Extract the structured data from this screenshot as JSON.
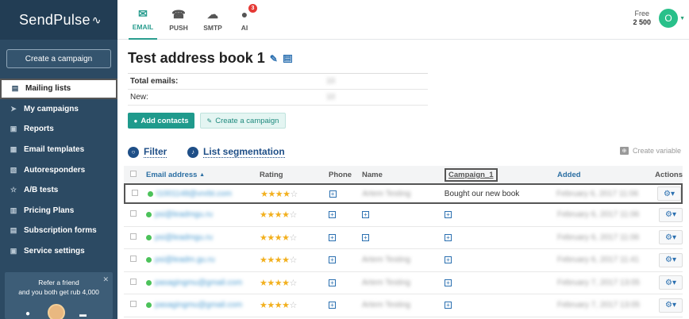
{
  "brand": {
    "name": "SendPulse",
    "pulse": "∠"
  },
  "sidebar": {
    "create_campaign": "Create a campaign",
    "items": [
      {
        "label": "Mailing lists",
        "icon": "book-icon",
        "glyph": "▤"
      },
      {
        "label": "My campaigns",
        "icon": "paper-plane-icon",
        "glyph": "➤"
      },
      {
        "label": "Reports",
        "icon": "chart-icon",
        "glyph": "▣"
      },
      {
        "label": "Email templates",
        "icon": "template-icon",
        "glyph": "▦"
      },
      {
        "label": "Autoresponders",
        "icon": "autoresponder-icon",
        "glyph": "▧"
      },
      {
        "label": "A/B tests",
        "icon": "ab-test-icon",
        "glyph": "☆"
      },
      {
        "label": "Pricing Plans",
        "icon": "pricing-icon",
        "glyph": "▥"
      },
      {
        "label": "Subscription forms",
        "icon": "form-icon",
        "glyph": "▤"
      },
      {
        "label": "Service settings",
        "icon": "settings-icon",
        "glyph": "▣"
      }
    ],
    "refer": {
      "line1": "Refer a friend",
      "line2": "and you both get rub 4,000"
    }
  },
  "topbar": {
    "tabs": [
      {
        "label": "EMAIL",
        "glyph": "✉"
      },
      {
        "label": "PUSH",
        "glyph": "☎"
      },
      {
        "label": "SMTP",
        "glyph": "☁"
      },
      {
        "label": "AI",
        "glyph": "●",
        "badge": "3"
      }
    ],
    "plan_label": "Free",
    "plan_value": "2 500",
    "avatar_letter": "O"
  },
  "page": {
    "title": "Test address book 1",
    "stats": [
      {
        "label": "Total emails:",
        "value": "10"
      },
      {
        "label": "New:",
        "value": "10"
      }
    ],
    "add_contacts": "Add contacts",
    "create_campaign": "Create a campaign",
    "filter": "Filter",
    "segmentation": "List segmentation",
    "create_variable": "Create variable"
  },
  "table": {
    "headers": {
      "email": "Email address",
      "rating": "Rating",
      "phone": "Phone",
      "name": "Name",
      "campaign": "Campaign_1",
      "added": "Added",
      "actions": "Actions"
    },
    "rows": [
      {
        "email": "t1001148@vnrbt.com",
        "rating": 4,
        "name": "Artem Testing",
        "campaign": "Bought our new book",
        "added": "February 6, 2017 11:06"
      },
      {
        "email": "psi@leadmgu.ru",
        "rating": 4,
        "name": "",
        "campaign": "",
        "added": "February 6, 2017 11:06"
      },
      {
        "email": "psi@leadmgu.ru",
        "rating": 4,
        "name": "",
        "campaign": "",
        "added": "February 6, 2017 11:06"
      },
      {
        "email": "psi@leadm.gu.ru",
        "rating": 4,
        "name": "Artem Testing",
        "campaign": "",
        "added": "February 6, 2017 11:41"
      },
      {
        "email": "pasagingmu@gmail.com",
        "rating": 4,
        "name": "Artem Testing",
        "campaign": "",
        "added": "February 7, 2017 13:05"
      },
      {
        "email": "pasagingmu@gmail.com",
        "rating": 4,
        "name": "Artem Testing",
        "campaign": "",
        "added": "February 7, 2017 13:05"
      }
    ]
  }
}
